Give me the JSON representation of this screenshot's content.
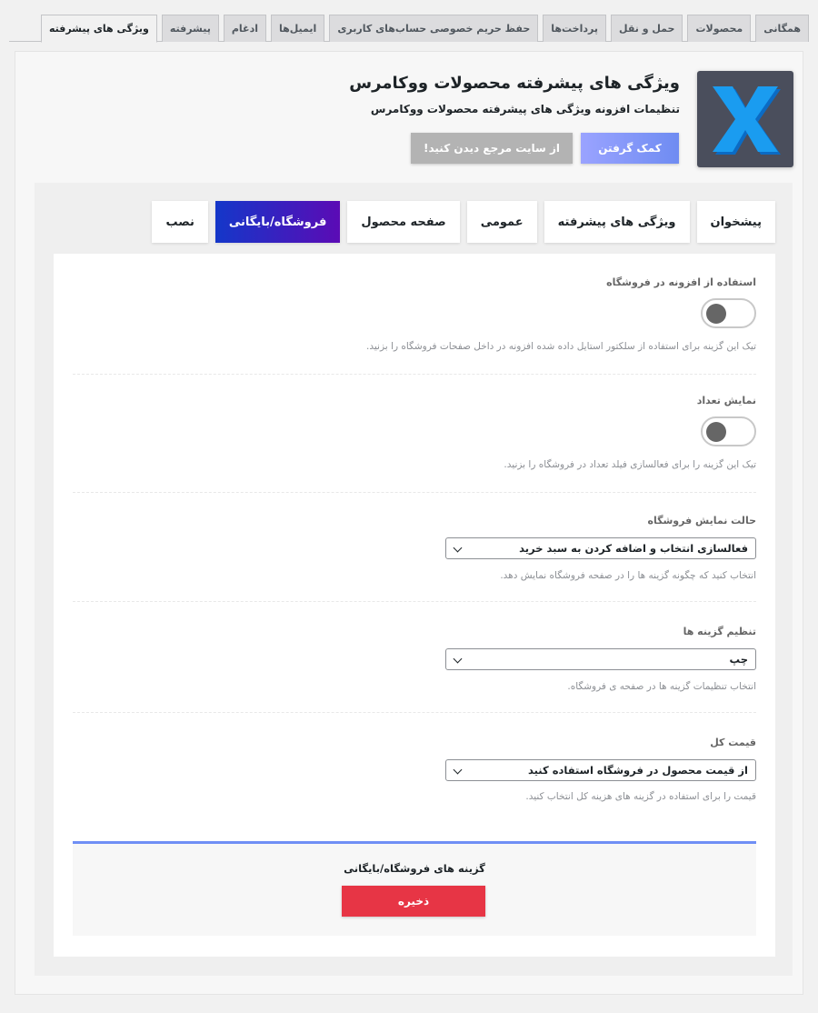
{
  "wc_tabs": [
    {
      "label": "همگانی"
    },
    {
      "label": "محصولات"
    },
    {
      "label": "حمل و نقل"
    },
    {
      "label": "پرداخت‌ها"
    },
    {
      "label": "حفظ حریم خصوصی حساب‌های کاربری"
    },
    {
      "label": "ایمیل‌ها"
    },
    {
      "label": "ادغام"
    },
    {
      "label": "پیشرفته"
    },
    {
      "label": "ویژگی های پیشرفته"
    }
  ],
  "wc_active_tab": "ویژگی های پیشرفته",
  "header": {
    "title": "ویژگی های پیشرفته محصولات ووکامرس",
    "subtitle": "تنظیمات افزونه ویژگی های پیشرفته محصولات ووکامرس",
    "help_button": "کمک گرفتن",
    "reference_button": "از سایت مرجع دیدن کنید!",
    "logo_letter": "X",
    "logo_color": "#1a9cf0"
  },
  "section_tabs": [
    {
      "label": "پیشخوان"
    },
    {
      "label": "ویژگی های پیشرفته"
    },
    {
      "label": "عمومی"
    },
    {
      "label": "صفحه محصول"
    },
    {
      "label": "فروشگاه/بایگانی"
    },
    {
      "label": "نصب"
    }
  ],
  "section_active_tab": "فروشگاه/بایگانی",
  "fields": {
    "use_in_shop": {
      "label": "استفاده از افزونه در فروشگاه",
      "enabled": false,
      "description": "تیک این گزینه برای استفاده از سلکتور استایل داده شده افزونه در داخل صفحات فروشگاه را بزنید."
    },
    "show_qty": {
      "label": "نمایش تعداد",
      "enabled": false,
      "description": "تیک این گزینه را برای فعالسازی فیلد تعداد در فروشگاه را بزنید."
    },
    "shop_mode": {
      "label": "حالت نمایش فروشگاه",
      "value": "فعالسازی انتخاب و اضافه کردن به سبد خرید",
      "description": "انتخاب کنید که چگونه گزینه ها را در صفحه فروشگاه نمایش دهد."
    },
    "options_align": {
      "label": "تنظیم گزینه ها",
      "value": "چپ",
      "description": "انتخاب تنظیمات گزینه ها در صفحه ی فروشگاه."
    },
    "total_price": {
      "label": "قیمت کل",
      "value": "از قیمت محصول در فروشگاه استفاده کنید",
      "description": "قیمت را برای استفاده در گزینه های هزینه کل انتخاب کنید."
    }
  },
  "save_box": {
    "label": "گزینه های فروشگاه/بایگانی",
    "button": "ذخیره"
  }
}
